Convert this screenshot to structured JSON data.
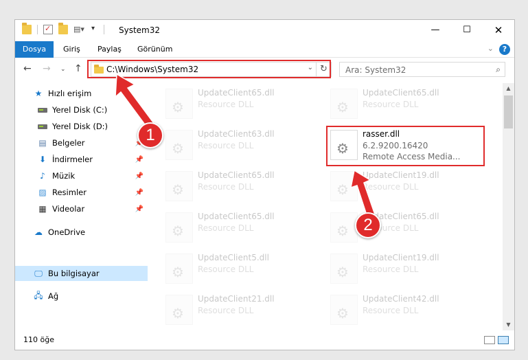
{
  "window": {
    "title": "System32"
  },
  "ribbon": {
    "tabs": [
      "Dosya",
      "Giriş",
      "Paylaş",
      "Görünüm"
    ],
    "help": "?"
  },
  "address": {
    "path": "C:\\Windows\\System32",
    "search_placeholder": "Ara: System32"
  },
  "sidebar": {
    "items": [
      {
        "label": "Hızlı erişim",
        "icon": "star-icon"
      },
      {
        "label": "Yerel Disk (C:)",
        "icon": "drive-icon"
      },
      {
        "label": "Yerel Disk (D:)",
        "icon": "drive-icon"
      },
      {
        "label": "Belgeler",
        "icon": "document-icon"
      },
      {
        "label": "İndirmeler",
        "icon": "download-icon"
      },
      {
        "label": "Müzik",
        "icon": "music-icon"
      },
      {
        "label": "Resimler",
        "icon": "picture-icon"
      },
      {
        "label": "Videolar",
        "icon": "video-icon"
      },
      {
        "label": "OneDrive",
        "icon": "cloud-icon"
      },
      {
        "label": "Bu bilgisayar",
        "icon": "computer-icon"
      },
      {
        "label": "Ağ",
        "icon": "network-icon"
      }
    ]
  },
  "files": {
    "left": [
      {
        "name": "UpdateClient65.dll",
        "type": "Resource DLL"
      },
      {
        "name": "UpdateClient63.dll",
        "type": "Resource DLL"
      },
      {
        "name": "UpdateClient65.dll",
        "type": "Resource DLL"
      },
      {
        "name": "UpdateClient65.dll",
        "type": "Resource DLL"
      },
      {
        "name": "UpdateClient5.dll",
        "type": "Resource DLL"
      },
      {
        "name": "UpdateClient21.dll",
        "type": "Resource DLL"
      }
    ],
    "right": [
      {
        "name": "UpdateClient65.dll",
        "type": "Resource DLL"
      },
      {
        "name": "UpdateClient19.dll",
        "type": "Resource DLL"
      },
      {
        "name": "UpdateClient65.dll",
        "type": "Resource DLL"
      },
      {
        "name": "UpdateClient19.dll",
        "type": "Resource DLL"
      },
      {
        "name": "UpdateClient42.dll",
        "type": "Resource DLL"
      }
    ],
    "highlighted": {
      "name": "rasser.dll",
      "version": "6.2.9200.16420",
      "description": "Remote Access Media..."
    }
  },
  "status": {
    "count": "110 öğe"
  },
  "annotations": {
    "badge1": "1",
    "badge2": "2"
  },
  "colors": {
    "accent": "#1979ca",
    "annotation": "#e02b2b",
    "selection": "#cce8ff"
  }
}
